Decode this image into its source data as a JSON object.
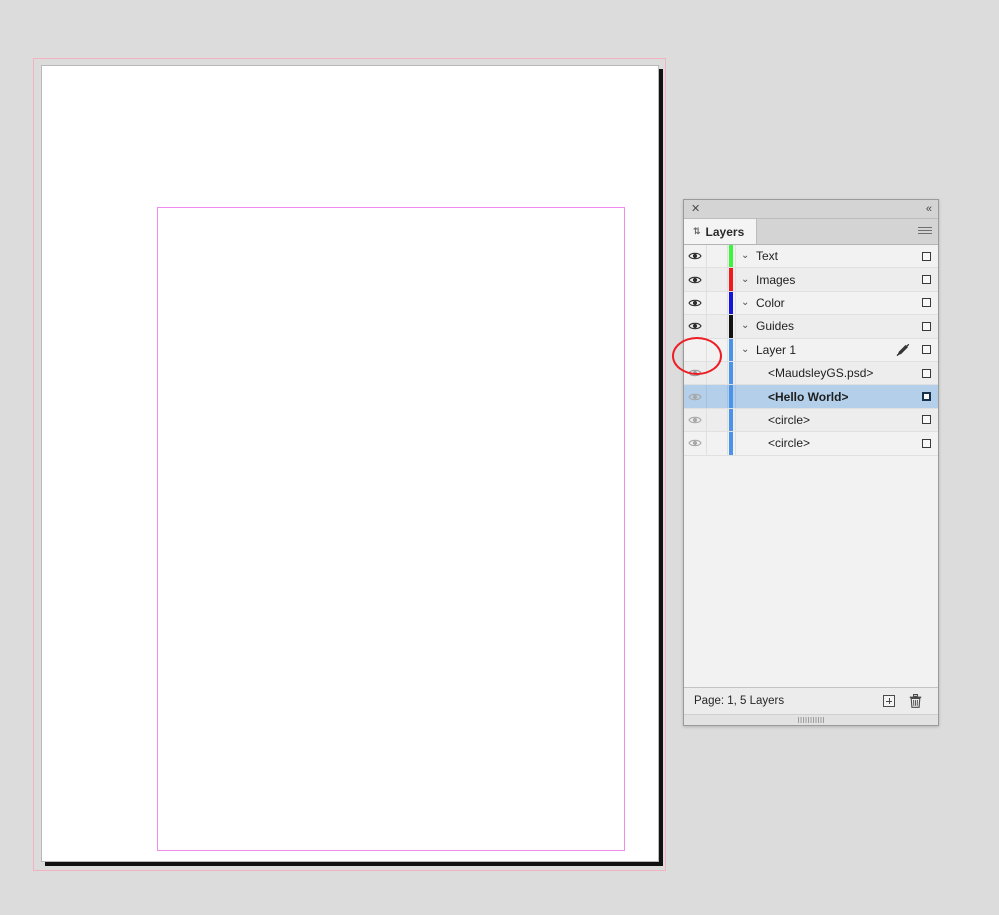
{
  "document": {
    "page_background": "#ffffff",
    "workspace_background": "#dcdcdc",
    "bleed_guide_color": "#f2b3c0",
    "margin_guide_color": "#f08cf0",
    "page_border_color": "#b9b9b9",
    "page_shadow_color": "#111111"
  },
  "panel": {
    "title_tab": "Layers",
    "close_icon": "✕",
    "collapse_icon": "«",
    "tab_grip_icon": "⇅",
    "menu_icon": "hamburger-menu-icon",
    "footer": {
      "status": "Page: 1, 5 Layers",
      "new_layer_label": "Create new layer",
      "delete_label": "Delete selected layers",
      "trash_icon": "🗑"
    },
    "rows": [
      {
        "name": "Text",
        "chip": "#3ef53e",
        "visible": true,
        "eye_style": "dark",
        "expanded": true,
        "chevron": "⌄",
        "child": false,
        "selected": false,
        "locked": false,
        "target": true
      },
      {
        "name": "Images",
        "chip": "#f01a1a",
        "visible": true,
        "eye_style": "dark",
        "expanded": true,
        "chevron": "⌄",
        "child": false,
        "selected": false,
        "locked": false,
        "target": true
      },
      {
        "name": "Color",
        "chip": "#1414dc",
        "visible": true,
        "eye_style": "dark",
        "expanded": true,
        "chevron": "⌄",
        "child": false,
        "selected": false,
        "locked": false,
        "target": true
      },
      {
        "name": "Guides",
        "chip": "#121212",
        "visible": true,
        "eye_style": "dark",
        "expanded": true,
        "chevron": "⌄",
        "child": false,
        "selected": false,
        "locked": false,
        "target": true
      },
      {
        "name": "Layer 1",
        "chip": "#4a93e8",
        "visible": false,
        "eye_style": "none",
        "expanded": true,
        "chevron": "⌄",
        "child": false,
        "selected": false,
        "locked": true,
        "target": true
      },
      {
        "name": "<MaudsleyGS.psd>",
        "chip": "#4a93e8",
        "visible": true,
        "eye_style": "faint",
        "expanded": false,
        "chevron": "",
        "child": true,
        "selected": false,
        "locked": false,
        "target": true
      },
      {
        "name": "<Hello World>",
        "chip": "#4a93e8",
        "visible": true,
        "eye_style": "light",
        "expanded": false,
        "chevron": "",
        "child": true,
        "selected": true,
        "locked": false,
        "target": true
      },
      {
        "name": "<circle>",
        "chip": "#4a93e8",
        "visible": true,
        "eye_style": "light",
        "expanded": false,
        "chevron": "",
        "child": true,
        "selected": false,
        "locked": false,
        "target": true
      },
      {
        "name": "<circle>",
        "chip": "#4a93e8",
        "visible": true,
        "eye_style": "light",
        "expanded": false,
        "chevron": "",
        "child": true,
        "selected": false,
        "locked": false,
        "target": true
      }
    ]
  },
  "annotation": {
    "shape": "ellipse",
    "color": "#ee1c24",
    "targets": "layer-1-visibility-toggle"
  }
}
